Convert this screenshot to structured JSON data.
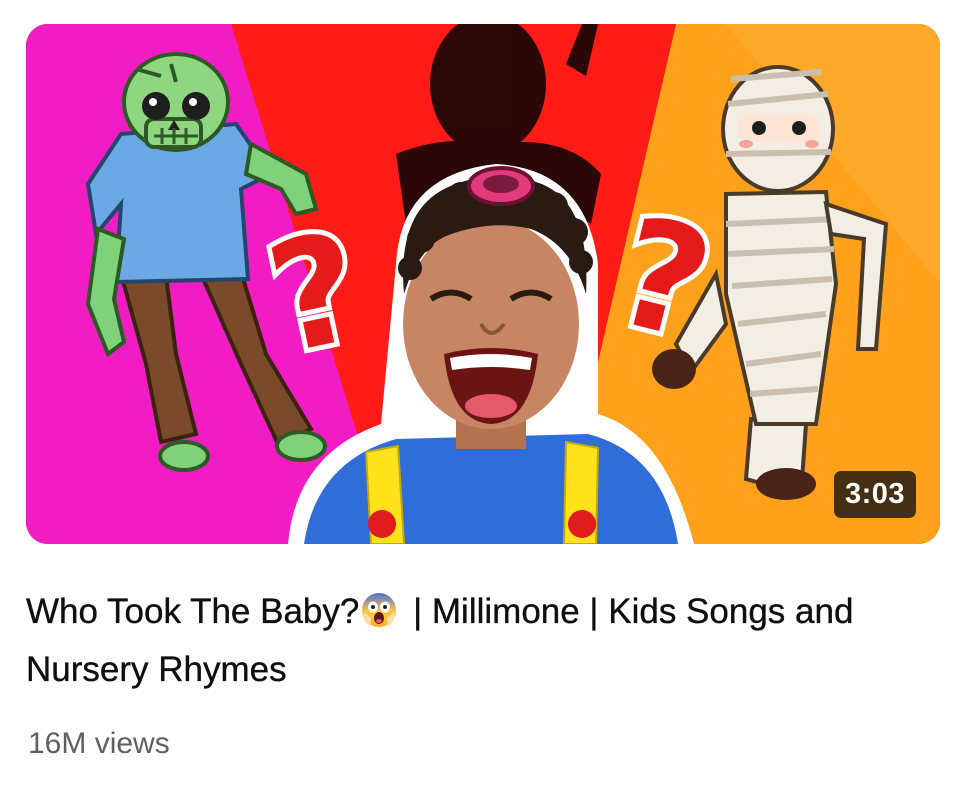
{
  "video": {
    "title_part1": "Who Took The Baby?",
    "title_emoji": "screaming-face-emoji",
    "title_part2": " | Millimone | Kids Songs and Nursery Rhymes",
    "duration": "3:03",
    "views": "16M views"
  },
  "colors": {
    "left_panel": "#f21cc4",
    "center_panel": "#ff1b16",
    "right_panel": "#ffa11a",
    "duration_bg": "#2a1f16",
    "title_text": "#0f0f0f",
    "meta_text": "#606060"
  }
}
